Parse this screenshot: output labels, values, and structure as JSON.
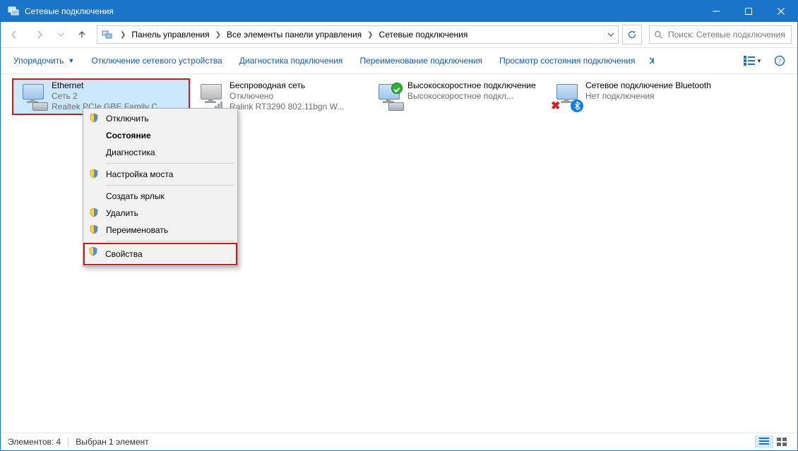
{
  "titlebar": {
    "title": "Сетевые подключения"
  },
  "breadcrumbs": {
    "item1": "Панель управления",
    "item2": "Все элементы панели управления",
    "item3": "Сетевые подключения"
  },
  "search": {
    "placeholder": "Поиск: Сетевые подключения"
  },
  "commands": {
    "organize": "Упорядочить",
    "disable_device": "Отключение сетевого устройства",
    "diagnose": "Диагностика подключения",
    "rename": "Переименование подключения",
    "view_status": "Просмотр состояния подключения"
  },
  "connections": [
    {
      "name": "Ethernet",
      "status": "Сеть  2",
      "device": "Realtek PCIe GBE Family C..."
    },
    {
      "name": "Беспроводная сеть",
      "status": "Отключено",
      "device": "Ralink RT3290 802.11bgn W..."
    },
    {
      "name": "Высокоскоростное подключение",
      "status": "",
      "device": "Высокоскоростное подкл..."
    },
    {
      "name": "Сетевое подключение Bluetooth",
      "status": "",
      "device": "Нет подключения"
    }
  ],
  "context_menu": {
    "disable": "Отключить",
    "status": "Состояние",
    "diagnose": "Диагностика",
    "bridge": "Настройка моста",
    "shortcut": "Создать ярлык",
    "delete": "Удалить",
    "rename": "Переименовать",
    "properties": "Свойства"
  },
  "statusbar": {
    "count": "Элементов: 4",
    "selected": "Выбран 1 элемент"
  }
}
